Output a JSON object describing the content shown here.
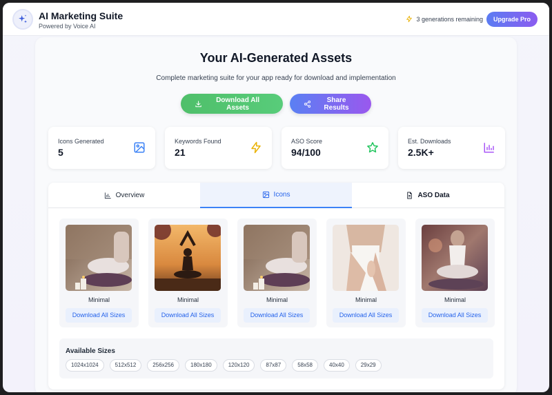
{
  "header": {
    "app_title": "AI Marketing Suite",
    "app_subtitle": "Powered by Voice AI",
    "logo_icon": "sparkles-icon",
    "generations_remaining": "3 generations remaining",
    "upgrade_label": "Upgrade Pro"
  },
  "main": {
    "title": "Your AI-Generated Assets",
    "subtitle": "Complete marketing suite for your app ready for download and implementation",
    "download_all_label": "Download All Assets",
    "share_label": "Share Results"
  },
  "stats": [
    {
      "label": "Icons Generated",
      "value": "5",
      "icon": "image-icon",
      "color": "#3b82f6"
    },
    {
      "label": "Keywords Found",
      "value": "21",
      "icon": "lightning-icon",
      "color": "#eab308"
    },
    {
      "label": "ASO Score",
      "value": "94/100",
      "icon": "star-icon",
      "color": "#22c55e"
    },
    {
      "label": "Est. Downloads",
      "value": "2.5K+",
      "icon": "bar-chart-icon",
      "color": "#a855f7"
    }
  ],
  "tabs": [
    {
      "label": "Overview",
      "icon": "bar-chart-icon",
      "active": false
    },
    {
      "label": "Icons",
      "icon": "image-icon",
      "active": true
    },
    {
      "label": "ASO Data",
      "icon": "document-icon",
      "active": false
    }
  ],
  "icons": [
    {
      "style": "Minimal",
      "button": "Download All Sizes",
      "image": "yoga-meditation-candles"
    },
    {
      "style": "Minimal",
      "button": "Download All Sizes",
      "image": "yoga-silhouette-sunset"
    },
    {
      "style": "Minimal",
      "button": "Download All Sizes",
      "image": "yoga-meditation-candles"
    },
    {
      "style": "Minimal",
      "button": "Download All Sizes",
      "image": "yoga-prayer-hands"
    },
    {
      "style": "Minimal",
      "button": "Download All Sizes",
      "image": "yoga-seated-pose"
    }
  ],
  "sizes": {
    "title": "Available Sizes",
    "items": [
      "1024x1024",
      "512x512",
      "256x256",
      "180x180",
      "120x120",
      "87x87",
      "58x58",
      "40x40",
      "29x29"
    ]
  }
}
